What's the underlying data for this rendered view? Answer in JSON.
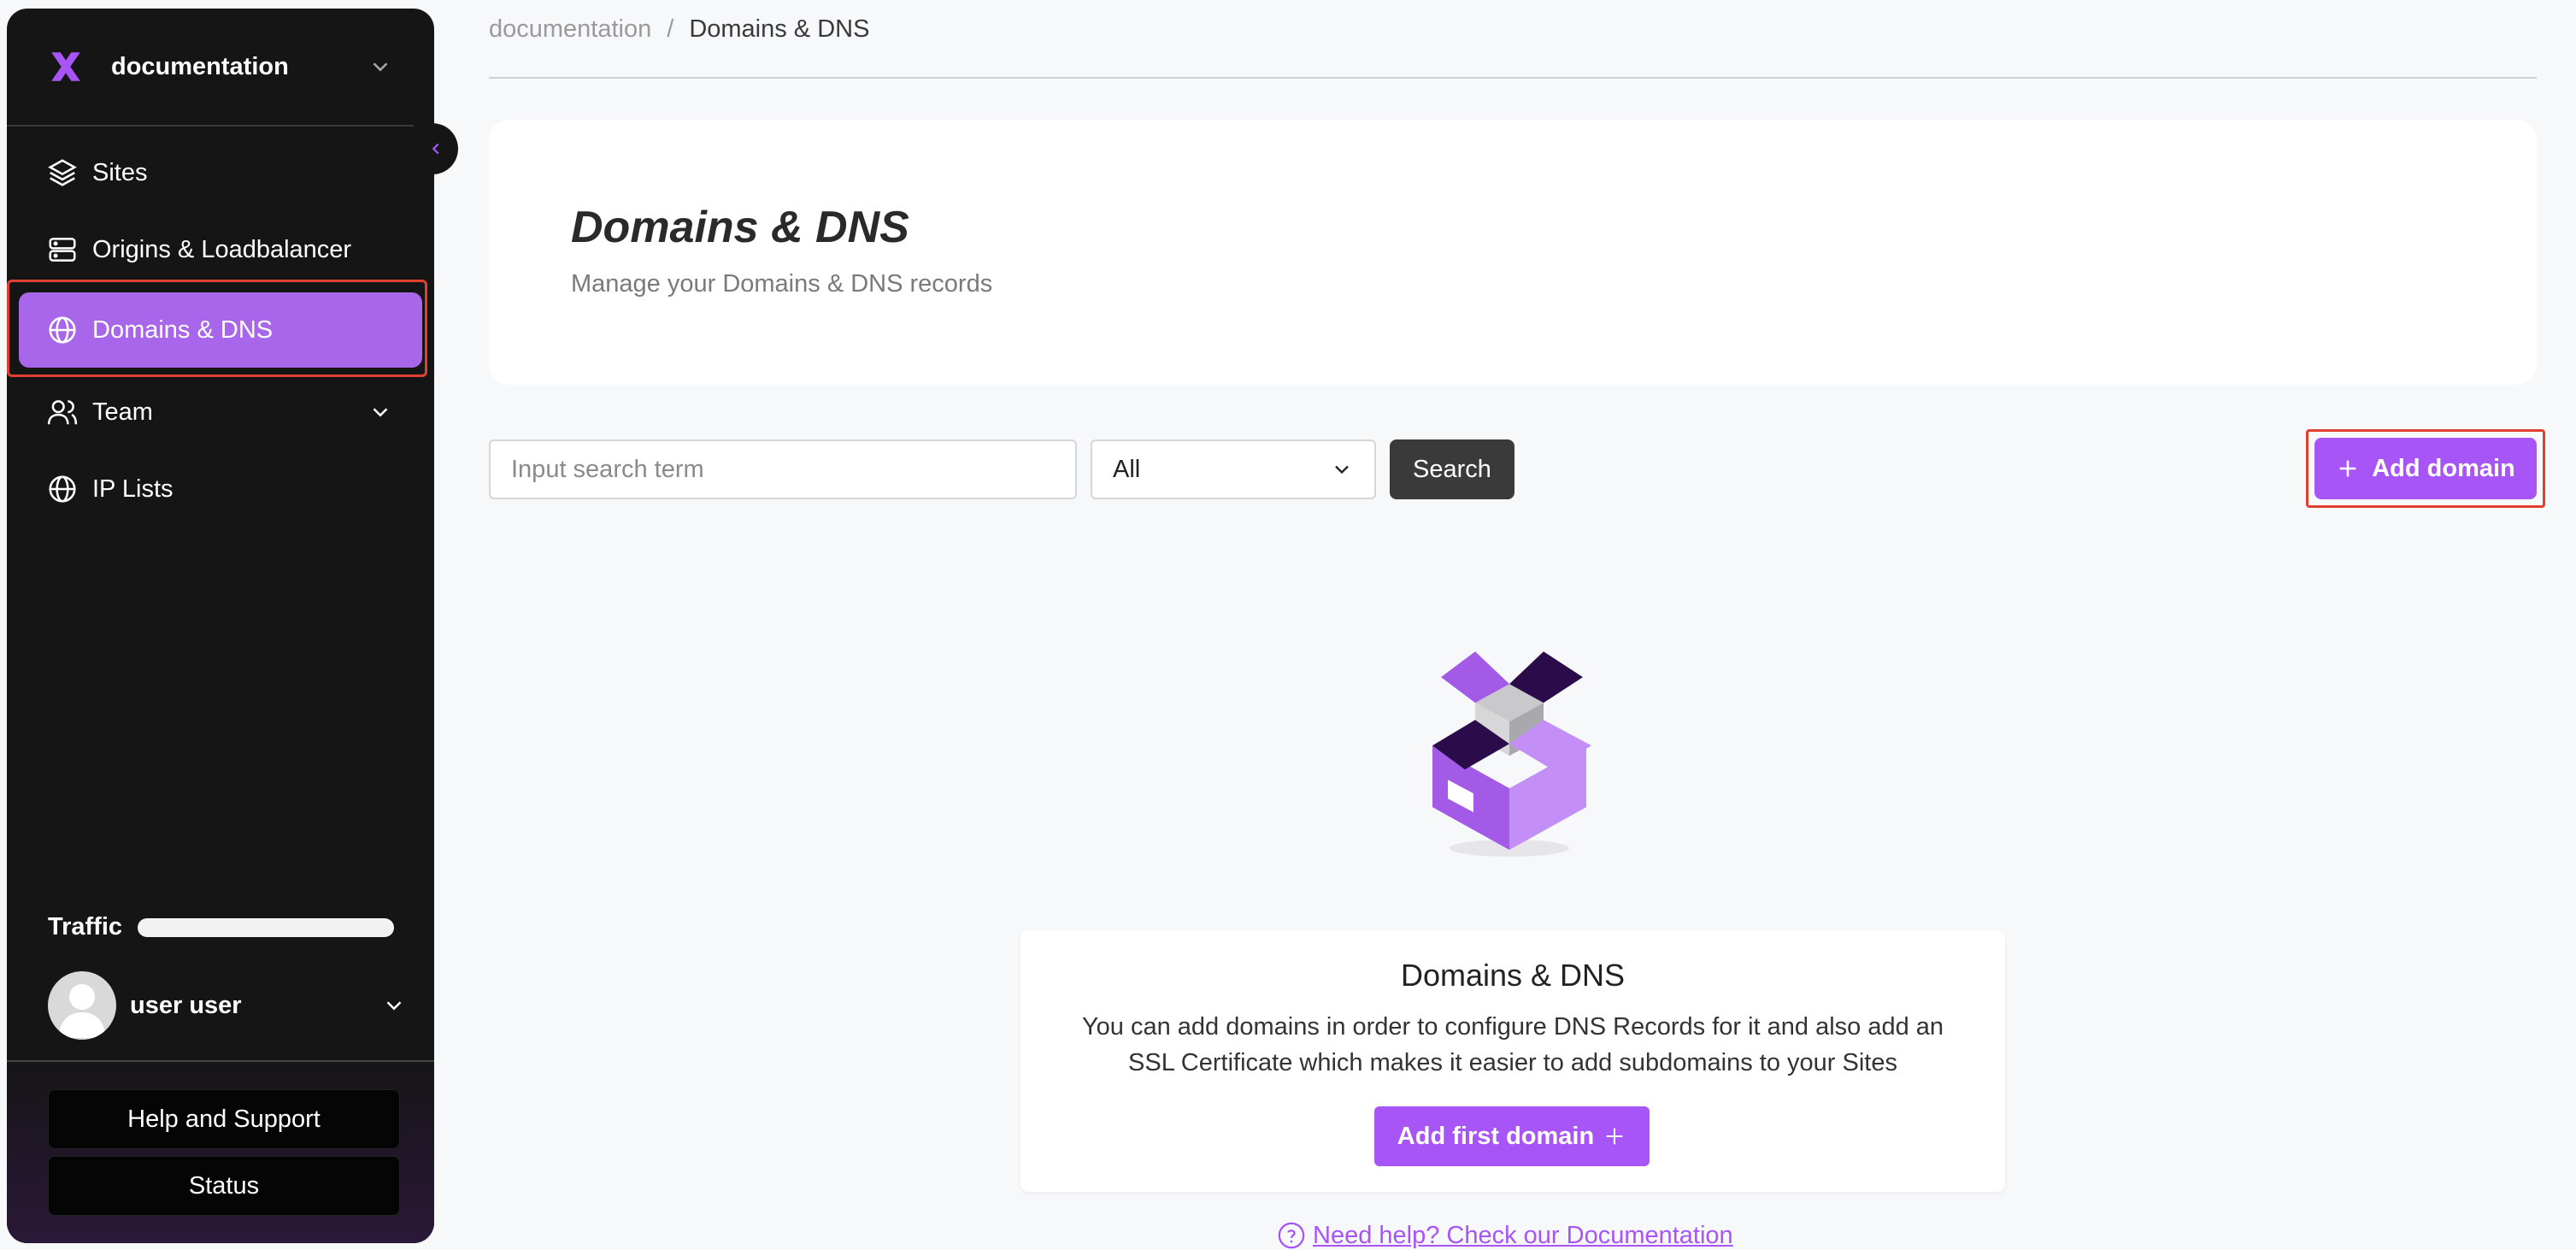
{
  "workspace": {
    "name": "documentation"
  },
  "sidebar": {
    "items": [
      {
        "label": "Sites",
        "icon": "layers-icon"
      },
      {
        "label": "Origins & Loadbalancer",
        "icon": "server-icon"
      },
      {
        "label": "Domains & DNS",
        "icon": "globe-icon",
        "active": true
      },
      {
        "label": "Team",
        "icon": "users-icon",
        "expandable": true
      },
      {
        "label": "IP Lists",
        "icon": "globe-icon"
      }
    ],
    "traffic_label": "Traffic",
    "user_name": "user user",
    "help_label": "Help and Support",
    "status_label": "Status"
  },
  "breadcrumb": {
    "parent": "documentation",
    "separator": "/",
    "current": "Domains & DNS"
  },
  "header": {
    "title": "Domains & DNS",
    "subtitle": "Manage your Domains & DNS records"
  },
  "toolbar": {
    "search_placeholder": "Input search term",
    "filter_value": "All",
    "search_label": "Search",
    "add_label": "Add domain"
  },
  "empty_state": {
    "title": "Domains & DNS",
    "text": "You can add domains in order to configure DNS Records for it and also add an SSL Certificate which makes it easier to add subdomains to your Sites",
    "button_label": "Add first domain"
  },
  "help_link": "Need help? Check our Documentation",
  "colors": {
    "accent": "#a855f7",
    "sidebar_bg": "#151515",
    "highlight": "#e0412f"
  }
}
